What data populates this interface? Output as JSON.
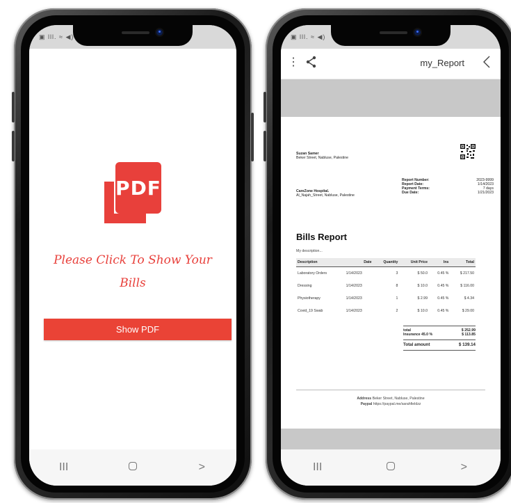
{
  "left_phone": {
    "status_icons": "▣ lll. ≈ ◀)",
    "logo_text": "PDF",
    "prompt_line1": "Please Click To Show Your",
    "prompt_line2": "Bills",
    "show_button": "Show PDF",
    "nav": {
      "recents": "III",
      "back": ">"
    }
  },
  "right_phone": {
    "status_icons": "▣ lll. ≈ ◀)",
    "toolbar_title": "my_Report",
    "report": {
      "customer_name": "Suzan Samer",
      "customer_address": "Beker Street, Nabluse, Palestine",
      "hospital_name": "CareZone Hospital.",
      "hospital_address": "Al_Najah_Street, Nabluse, Palestine",
      "meta_labels": [
        "Report Number:",
        "Report Date:",
        "Payment Terms:",
        "Due Date:"
      ],
      "meta_values": [
        "2023-9999",
        "1/14/2023",
        "7 days",
        "1/21/2023"
      ],
      "title": "Bills Report",
      "description": "My description...",
      "columns": [
        "Description",
        "Date",
        "Quantity",
        "Unit Price",
        "Ins",
        "Total"
      ],
      "rows": [
        [
          "Laboratory Orders",
          "1/14/2023",
          "3",
          "$ 50.0",
          "0.45 %",
          "$ 217.50"
        ],
        [
          "Dressing",
          "1/14/2023",
          "8",
          "$ 10.0",
          "0.45 %",
          "$ 116.00"
        ],
        [
          "Physiotherapy",
          "1/14/2023",
          "1",
          "$ 2.99",
          "0.45 %",
          "$ 4.34"
        ],
        [
          "Covid_19 Swab",
          "1/14/2023",
          "2",
          "$ 10.0",
          "0.45 %",
          "$ 29.00"
        ]
      ],
      "total_label": "total",
      "total_value": "$ 252.99",
      "insurance_label": "Insurance 45.0 %",
      "insurance_value": "$ 113.85",
      "total_amount_label": "Total amount",
      "total_amount_value": "$ 139.14",
      "footer_address_label": "Address",
      "footer_address": "Beker Street, Nabluse, Palestine",
      "footer_paypal_label": "Paypal",
      "footer_paypal": "https://paypal.me/sarahfieldzz"
    },
    "nav": {
      "recents": "III",
      "back": ">"
    }
  },
  "colors": {
    "accent": "#e8403b",
    "button": "#ea4336",
    "viewer_bg": "#c8c8c8"
  }
}
